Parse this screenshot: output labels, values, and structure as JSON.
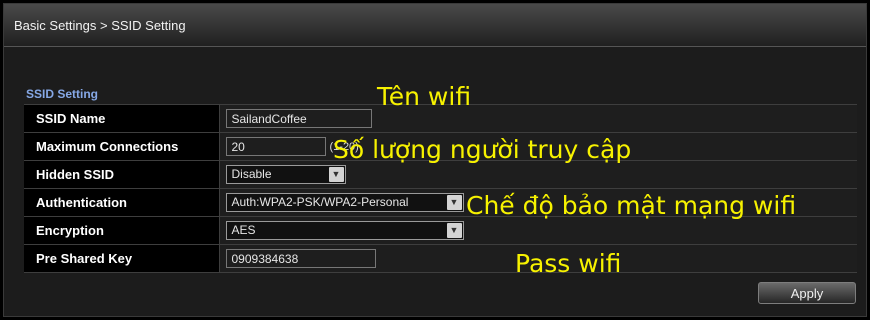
{
  "breadcrumb": "Basic Settings > SSID Setting",
  "section_title": "SSID Setting",
  "rows": [
    {
      "label": "SSID Name",
      "value": "SailandCoffee"
    },
    {
      "label": "Maximum Connections",
      "value": "20",
      "hint": "(1-20)"
    },
    {
      "label": "Hidden SSID",
      "value": "Disable"
    },
    {
      "label": "Authentication",
      "value": "Auth:WPA2-PSK/WPA2-Personal"
    },
    {
      "label": "Encryption",
      "value": "AES"
    },
    {
      "label": "Pre Shared Key",
      "value": "0909384638"
    }
  ],
  "annotations": {
    "ssid": "Tên wifi",
    "max_conn": "Số lượng người truy cập",
    "auth": "Chế độ bảo mật mạng wifi",
    "psk": "Pass wifi"
  },
  "apply_label": "Apply",
  "icons": {
    "dropdown": "chevron-down-icon"
  },
  "colors": {
    "annotation": "#f7f200",
    "section_title": "#86a8e6",
    "background": "#1c1c1c"
  }
}
